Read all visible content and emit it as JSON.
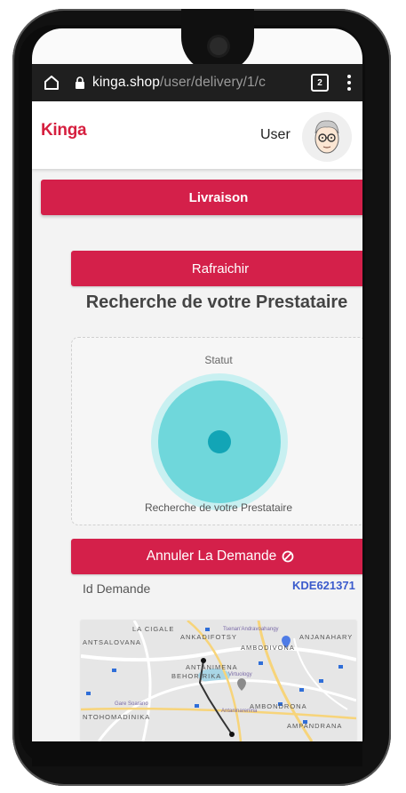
{
  "browser": {
    "url_host": "kinga.shop",
    "url_path": "/user/delivery/1/c",
    "tab_count": "2"
  },
  "header": {
    "logo_text": "Kinga",
    "user_label": "User"
  },
  "delivery": {
    "section_title": "Livraison",
    "refresh_label": "Rafraichir",
    "search_title": "Recherche de votre Prestataire",
    "status_label": "Statut",
    "status_caption": "Recherche de votre Prestataire",
    "cancel_label": "Annuler La Demande",
    "id_label": "Id Demande",
    "id_value": "KDE621371"
  },
  "map": {
    "labels": [
      "LA CIGALE",
      "ANKADIFOTSY",
      "ANJANAHARY",
      "ANTSALOVANA",
      "AMBODIVONA",
      "ANTANIMENA",
      "BEHORIRIKA",
      "AMBONDRONA",
      "NTOHOMADINIKA",
      "AMPANDRANA"
    ],
    "pois": [
      "Tsenan'Andravoahangy",
      "Virtuology",
      "Gare Soarano",
      "Antaninarenina"
    ]
  },
  "colors": {
    "brand": "#d4204a",
    "pulse_light": "#c8f0f1",
    "pulse_mid": "#6fd7db",
    "pulse_dot": "#12a5b6",
    "id_color": "#3b5bcc"
  }
}
